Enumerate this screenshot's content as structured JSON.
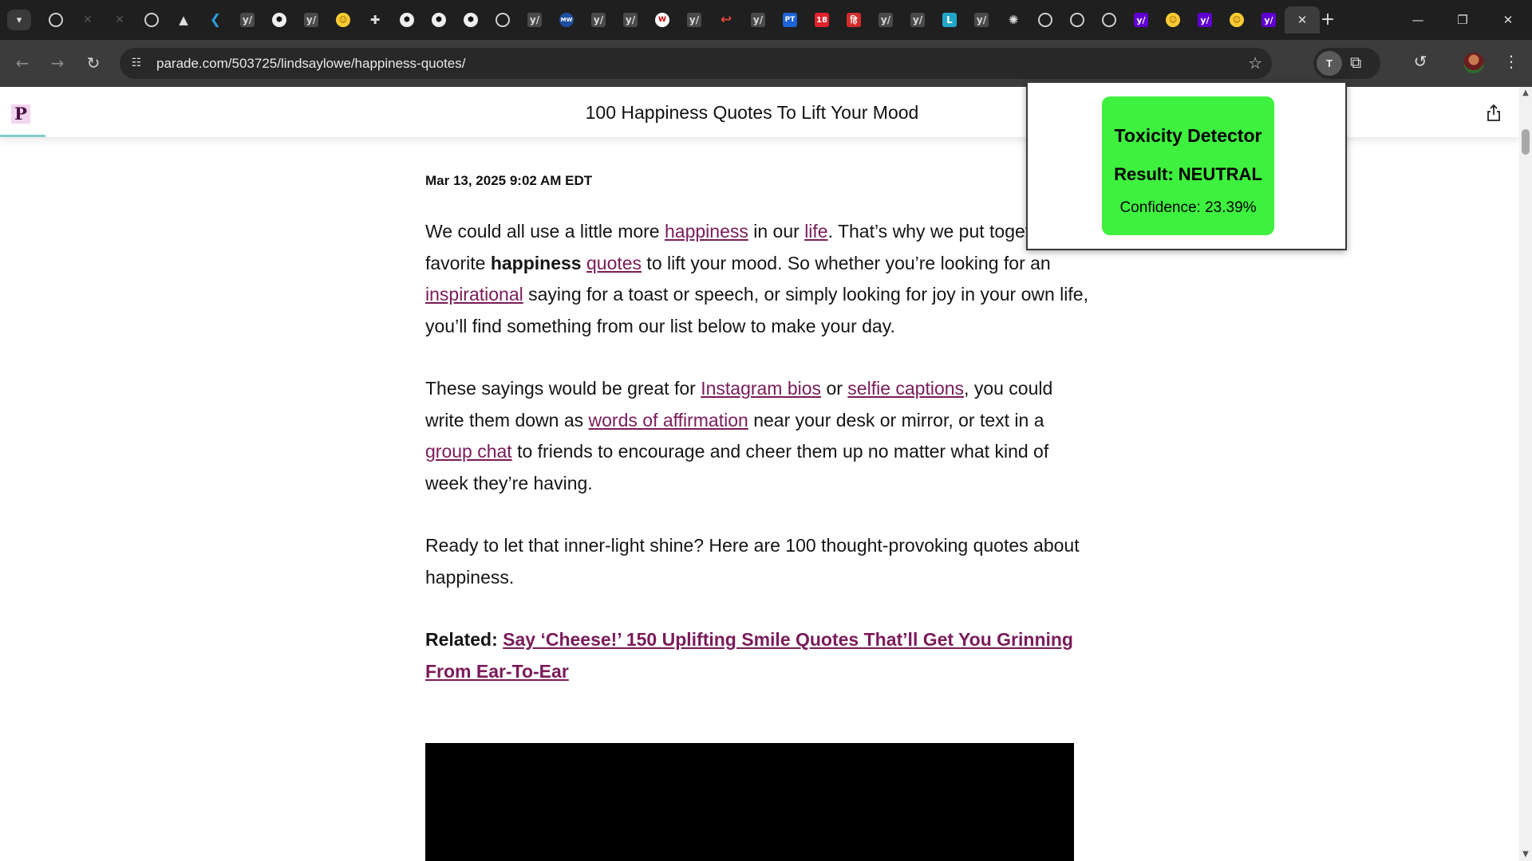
{
  "browser": {
    "tabs": [
      {
        "icon": "globe-icon",
        "glyph": ""
      },
      {
        "icon": "grid-icon",
        "glyph": "✕"
      },
      {
        "icon": "grid-icon",
        "glyph": "✕"
      },
      {
        "icon": "globe-icon",
        "glyph": ""
      },
      {
        "icon": "google-drive-icon",
        "glyph": "▲"
      },
      {
        "icon": "vscode-icon",
        "glyph": "❮"
      },
      {
        "icon": "ycombinator-icon",
        "glyph": "y/"
      },
      {
        "icon": "hexagon-icon",
        "glyph": "⬢"
      },
      {
        "icon": "ycombinator-icon",
        "glyph": "y/"
      },
      {
        "icon": "huggingface-icon",
        "glyph": "☺"
      },
      {
        "icon": "puzzle-icon",
        "glyph": "✚"
      },
      {
        "icon": "hexagon-icon",
        "glyph": "⬢"
      },
      {
        "icon": "hexagon-icon",
        "glyph": "⬢"
      },
      {
        "icon": "hexagon-icon",
        "glyph": "⬢"
      },
      {
        "icon": "globe-icon",
        "glyph": ""
      },
      {
        "icon": "ycombinator-icon",
        "glyph": "y/"
      },
      {
        "icon": "merriam-webster-icon",
        "glyph": "MW"
      },
      {
        "icon": "ycombinator-icon",
        "glyph": "y/"
      },
      {
        "icon": "ycombinator-icon",
        "glyph": "y/"
      },
      {
        "icon": "wikipedia-icon",
        "glyph": "W"
      },
      {
        "icon": "ycombinator-icon",
        "glyph": "y/"
      },
      {
        "icon": "reply-arrow-icon",
        "glyph": "↩"
      },
      {
        "icon": "ycombinator-icon",
        "glyph": "y/"
      },
      {
        "icon": "pt-icon",
        "glyph": "PT"
      },
      {
        "icon": "news18-icon",
        "glyph": "18"
      },
      {
        "icon": "hindi-news-icon",
        "glyph": "हि"
      },
      {
        "icon": "ycombinator-icon",
        "glyph": "y/"
      },
      {
        "icon": "ycombinator-icon",
        "glyph": "y/"
      },
      {
        "icon": "letter-l-icon",
        "glyph": "L"
      },
      {
        "icon": "ycombinator-icon",
        "glyph": "y/"
      },
      {
        "icon": "chatgpt-icon",
        "glyph": "✺"
      },
      {
        "icon": "globe-icon",
        "glyph": ""
      },
      {
        "icon": "globe-icon",
        "glyph": ""
      },
      {
        "icon": "globe-icon",
        "glyph": ""
      },
      {
        "icon": "yahoo-icon",
        "glyph": "y/"
      },
      {
        "icon": "huggingface-icon",
        "glyph": "☺"
      },
      {
        "icon": "yahoo-icon",
        "glyph": "y/"
      },
      {
        "icon": "huggingface-icon",
        "glyph": "☺"
      },
      {
        "icon": "yahoo-icon",
        "glyph": "y/"
      }
    ],
    "url": "parade.com/503725/lindsaylowe/happiness-quotes/",
    "extension_badge": "T"
  },
  "header": {
    "logo": "P",
    "title": "100 Happiness Quotes To Lift Your Mood"
  },
  "article": {
    "date": "Mar 13, 2025 9:02 AM EDT",
    "p1": {
      "t1": "We could all use a little more ",
      "l1": "happiness",
      "t2": " in our ",
      "l2": "life",
      "t3": ". That’s why we put together our favorite ",
      "b1": "happiness",
      "t4": " ",
      "l3": "quotes",
      "t5": " to lift your mood. So whether you’re looking for an ",
      "l4": "inspirational",
      "t6": " saying for a toast or speech, or simply looking for joy in your own life, you’ll find something from our list below to make your day."
    },
    "p2": {
      "t1": "These sayings would be great for ",
      "l1": "Instagram bios",
      "t2": " or ",
      "l2": "selfie captions",
      "t3": ", you could write them down as ",
      "l3": "words of affirmation",
      "t4": " near your desk or mirror, or text in a ",
      "l4": "group chat",
      "t5": " to friends to encourage and cheer them up no matter what kind of week they’re having."
    },
    "p3": "Ready to let that inner-light shine? Here are 100 thought-provoking quotes about happiness.",
    "related": {
      "label": "Related:",
      "link": "Say ‘Cheese!’ 150 Uplifting Smile Quotes That’ll Get You Grinning From Ear-To-Ear"
    }
  },
  "popup": {
    "title": "Toxicity Detector",
    "result": "Result: NEUTRAL",
    "confidence": "Confidence: 23.39%",
    "card_color": "#3ef13e"
  },
  "colors": {
    "link": "#7a1b5a",
    "chrome_dark": "#1f1f1f",
    "toolbar": "#3c3c3c"
  }
}
